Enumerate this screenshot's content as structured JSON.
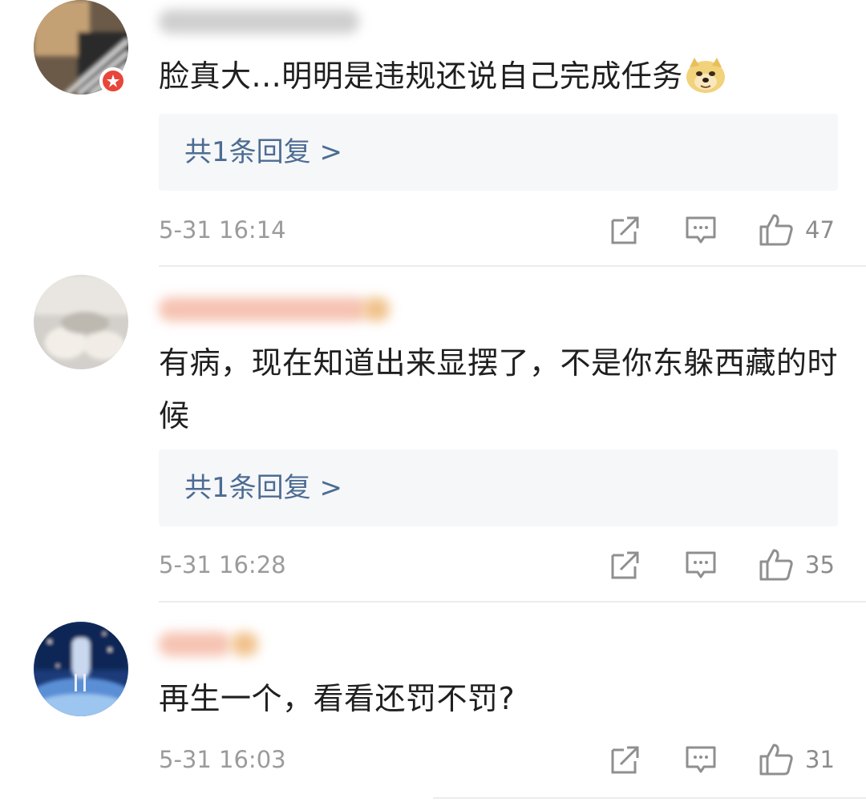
{
  "comments": [
    {
      "text": "脸真大...明明是违规还说自己完成任务",
      "emoji": "doge-emoji",
      "reply_label": "共1条回复 >",
      "timestamp": "5-31 16:14",
      "likes": "47"
    },
    {
      "text": "有病，现在知道出来显摆了，不是你东躲西藏的时候",
      "reply_label": "共1条回复 >",
      "timestamp": "5-31 16:28",
      "likes": "35"
    },
    {
      "text": "再生一个，看看还罚不罚?",
      "timestamp": "5-31 16:03",
      "likes": "31"
    }
  ],
  "icons": {
    "share": "share-icon",
    "comment": "comment-icon",
    "like": "thumbs-up-icon"
  },
  "colors": {
    "reply_link": "#4d6c93",
    "meta_text": "#9b9b9b",
    "badge": "#e8463a",
    "reply_bg": "#f6f7f9"
  }
}
